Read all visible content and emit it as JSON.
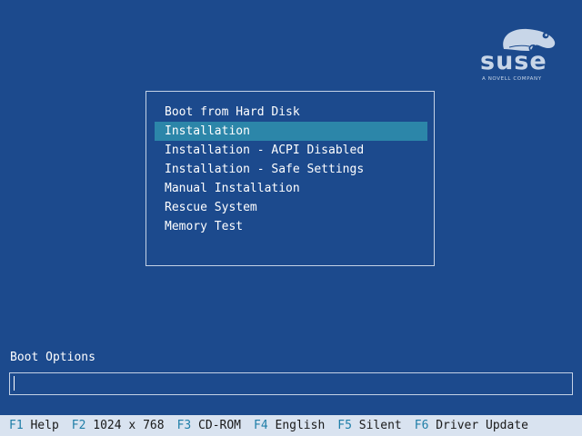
{
  "logo": {
    "word": "suse",
    "tagline": "A NOVELL COMPANY"
  },
  "menu": {
    "items": [
      {
        "label": "Boot from Hard Disk",
        "selected": false
      },
      {
        "label": "Installation",
        "selected": true
      },
      {
        "label": "Installation - ACPI Disabled",
        "selected": false
      },
      {
        "label": "Installation - Safe Settings",
        "selected": false
      },
      {
        "label": "Manual Installation",
        "selected": false
      },
      {
        "label": "Rescue System",
        "selected": false
      },
      {
        "label": "Memory Test",
        "selected": false
      }
    ]
  },
  "boot_options": {
    "label": "Boot Options",
    "value": ""
  },
  "function_keys": [
    {
      "key": "F1",
      "label": "Help"
    },
    {
      "key": "F2",
      "label": "1024 x 768"
    },
    {
      "key": "F3",
      "label": "CD-ROM"
    },
    {
      "key": "F4",
      "label": "English"
    },
    {
      "key": "F5",
      "label": "Silent"
    },
    {
      "key": "F6",
      "label": "Driver Update"
    }
  ],
  "colors": {
    "background": "#1c4a8d",
    "selection": "#2c86a9",
    "border": "#c4d2e6",
    "footer_bg": "#d9e3f0",
    "footer_key": "#1f7ea8"
  },
  "icons": {
    "logo": "chameleon-logo-icon"
  }
}
